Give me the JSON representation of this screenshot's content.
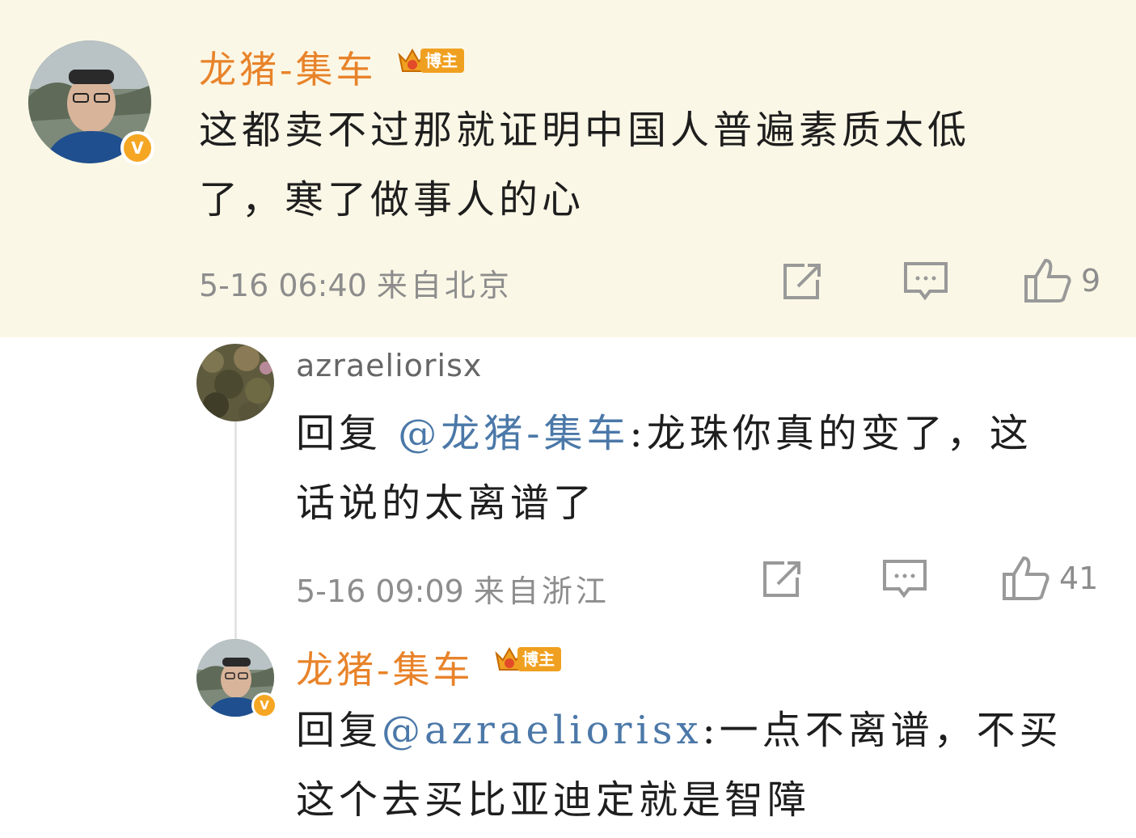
{
  "main_comment": {
    "author": "龙猪-集车",
    "badge_label": "博主",
    "badge_level": "7",
    "verified_mark": "V",
    "text_line1": "这都卖不过那就证明中国人普遍素质太低",
    "text_line2": "了，寒了做事人的心",
    "time": "5-16 06:40",
    "location": "来自北京",
    "like_count": "9"
  },
  "reply1": {
    "author": "azraeliorisx",
    "reply_prefix": "回复",
    "mention": "@龙猪-集车",
    "text_line1_rest": ":龙珠你真的变了，这",
    "text_line2": "话说的太离谱了",
    "time": "5-16 09:09",
    "location": "来自浙江",
    "like_count": "41"
  },
  "reply2": {
    "author": "龙猪-集车",
    "badge_label": "博主",
    "badge_level": "7",
    "verified_mark": "V",
    "reply_prefix": "回复",
    "mention": "@azraeliorisx",
    "text_line1_rest": ":一点不离谱，不买",
    "text_line2": "这个去买比亚迪定就是智障"
  },
  "icons": [
    "share-icon",
    "comment-icon",
    "like-icon",
    "crown-icon",
    "verified-icon"
  ],
  "colors": {
    "highlight_bg": "#fbf7e6",
    "author_orange": "#e8832a",
    "mention_blue": "#4b78a8",
    "meta_gray": "#8d8d8d",
    "verified_gold": "#f5a623"
  }
}
